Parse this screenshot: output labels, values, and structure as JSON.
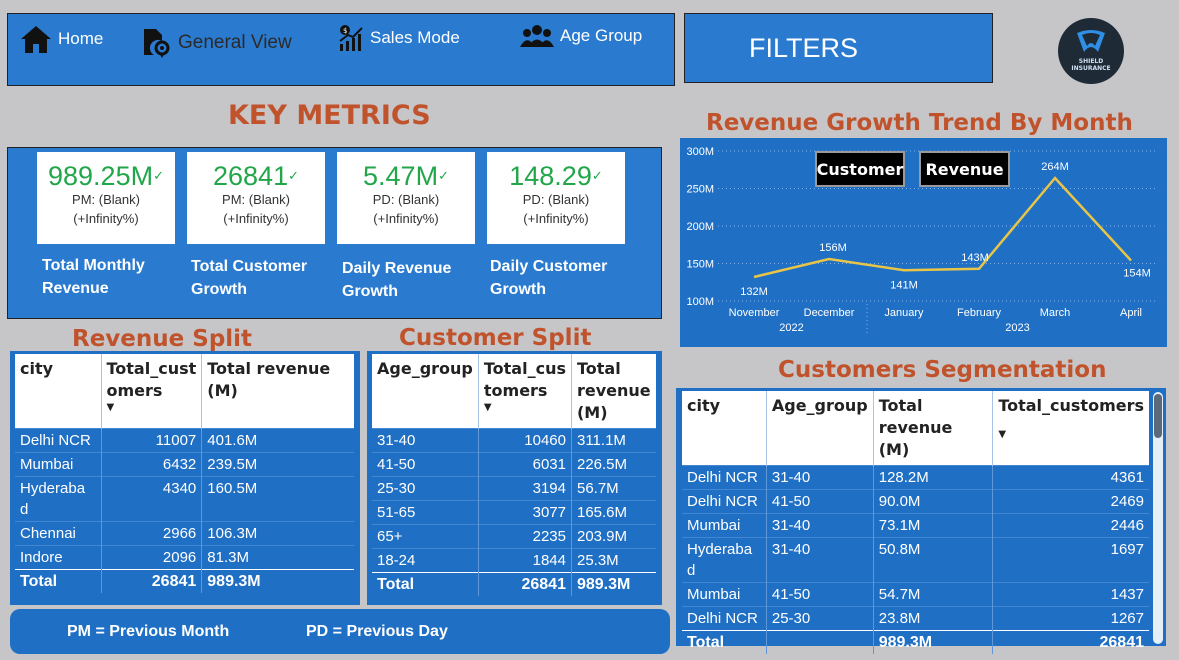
{
  "nav": {
    "home": "Home",
    "general_view": "General View",
    "sales_mode": "Sales Mode",
    "age_group": "Age Group",
    "filters": "FILTERS"
  },
  "logo": {
    "text_line1": "SHIELD",
    "text_line2": "INSURANCE"
  },
  "titles": {
    "key_metrics": "KEY METRICS",
    "revenue_trend": "Revenue Growth Trend By Month",
    "revenue_split": "Revenue Split",
    "customer_split": "Customer Split",
    "customers_segmentation": "Customers Segmentation"
  },
  "kpis": [
    {
      "value": "989.25M",
      "sub1": "PM: (Blank)",
      "sub2": "(+Infinity%)",
      "label1": "Total Monthly",
      "label2": "Revenue"
    },
    {
      "value": "26841",
      "sub1": "PM: (Blank)",
      "sub2": "(+Infinity%)",
      "label1": "Total Customer",
      "label2": "Growth"
    },
    {
      "value": "5.47M",
      "sub1": "PD: (Blank)",
      "sub2": "(+Infinity%)",
      "label1": "Daily Revenue",
      "label2": "Growth"
    },
    {
      "value": "148.29",
      "sub1": "PD: (Blank)",
      "sub2": "(+Infinity%)",
      "label1": "Daily Customer",
      "label2": "Growth"
    }
  ],
  "check_glyph": "✓",
  "chart_data": {
    "type": "line",
    "title": "Revenue Growth Trend By Month",
    "categories": [
      "November",
      "December",
      "January",
      "February",
      "March",
      "April"
    ],
    "year_groups": [
      {
        "label": "2022",
        "from": 0,
        "to": 1
      },
      {
        "label": "2023",
        "from": 2,
        "to": 5
      }
    ],
    "series": [
      {
        "values": [
          132,
          156,
          141,
          143,
          264,
          154
        ]
      }
    ],
    "data_labels": [
      "132M",
      "156M",
      "141M",
      "143M",
      "264M",
      "154M"
    ],
    "yticks": [
      "100M",
      "150M",
      "200M",
      "250M",
      "300M"
    ],
    "ylim": [
      100,
      300
    ],
    "grid": true,
    "line_color": "#e8c547",
    "legend_buttons": [
      "Customer",
      "Revenue"
    ]
  },
  "revenue_split": {
    "headers": [
      "city",
      "Total_cust omers",
      "Total revenue (M)"
    ],
    "sort_glyph": "▼",
    "rows": [
      [
        "Delhi NCR",
        "11007",
        "401.6M"
      ],
      [
        "Mumbai",
        "6432",
        "239.5M"
      ],
      [
        "Hyderaba d",
        "4340",
        "160.5M"
      ],
      [
        "Chennai",
        "2966",
        "106.3M"
      ],
      [
        "Indore",
        "2096",
        "81.3M"
      ]
    ],
    "total": [
      "Total",
      "26841",
      "989.3M"
    ]
  },
  "customer_split": {
    "headers": [
      "Age_group",
      "Total_cus tomers",
      "Total revenue (M)"
    ],
    "sort_glyph": "▼",
    "rows": [
      [
        "31-40",
        "10460",
        "311.1M"
      ],
      [
        "41-50",
        "6031",
        "226.5M"
      ],
      [
        "25-30",
        "3194",
        "56.7M"
      ],
      [
        "51-65",
        "3077",
        "165.6M"
      ],
      [
        "65+",
        "2235",
        "203.9M"
      ],
      [
        "18-24",
        "1844",
        "25.3M"
      ]
    ],
    "total": [
      "Total",
      "26841",
      "989.3M"
    ]
  },
  "segmentation": {
    "headers": [
      "city",
      "Age_group",
      "Total revenue (M)",
      "Total_customers"
    ],
    "sort_glyph": "▼",
    "rows": [
      [
        "Delhi NCR",
        "31-40",
        "128.2M",
        "4361"
      ],
      [
        "Delhi NCR",
        "41-50",
        "90.0M",
        "2469"
      ],
      [
        "Mumbai",
        "31-40",
        "73.1M",
        "2446"
      ],
      [
        "Hyderaba d",
        "31-40",
        "50.8M",
        "1697"
      ],
      [
        "Mumbai",
        "41-50",
        "54.7M",
        "1437"
      ],
      [
        "Delhi NCR",
        "25-30",
        "23.8M",
        "1267"
      ]
    ],
    "total": [
      "Total",
      "",
      "989.3M",
      "26841"
    ]
  },
  "footer": {
    "pm": "PM = Previous Month",
    "pd": "PD = Previous Day"
  }
}
